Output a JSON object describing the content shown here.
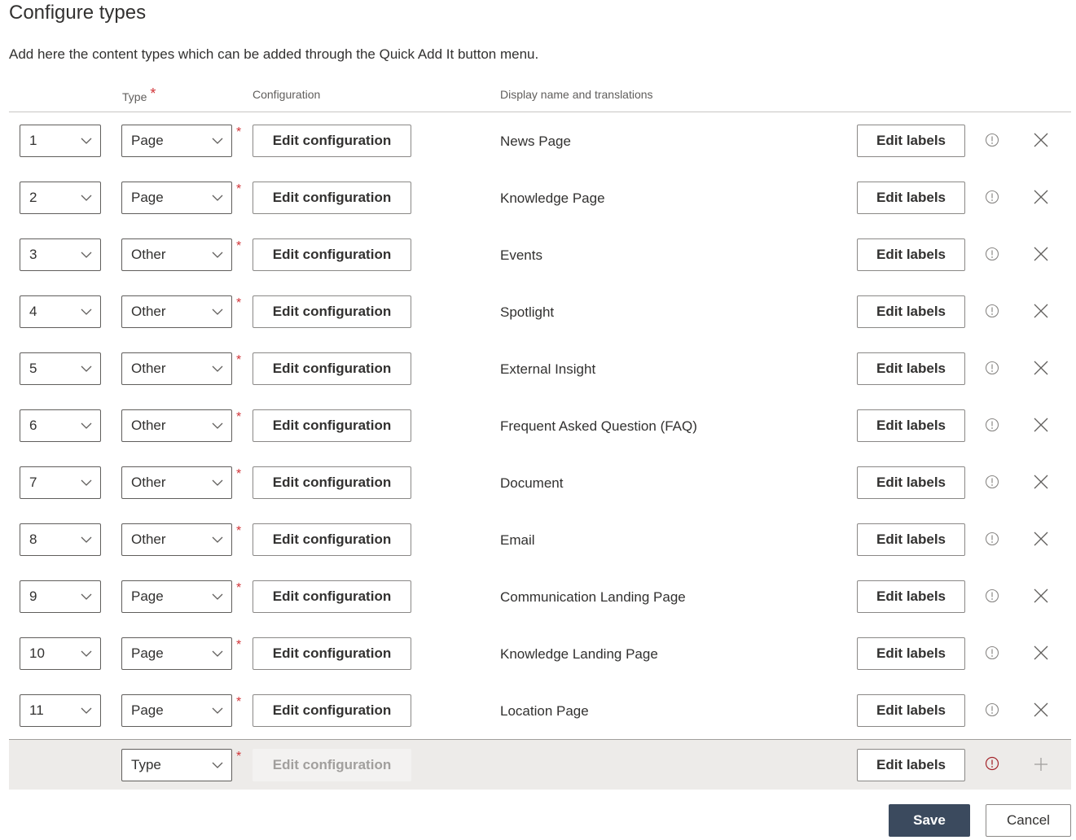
{
  "page": {
    "title": "Configure types",
    "description": "Add here the content types which can be added through the Quick Add It button menu."
  },
  "headers": {
    "type": "Type",
    "configuration": "Configuration",
    "display_name": "Display name and translations",
    "required_mark": "*"
  },
  "rows": [
    {
      "order": "1",
      "type": "Page",
      "config_label": "Edit configuration",
      "display_name": "News Page",
      "labels_label": "Edit labels"
    },
    {
      "order": "2",
      "type": "Page",
      "config_label": "Edit configuration",
      "display_name": "Knowledge Page",
      "labels_label": "Edit labels"
    },
    {
      "order": "3",
      "type": "Other",
      "config_label": "Edit configuration",
      "display_name": "Events",
      "labels_label": "Edit labels"
    },
    {
      "order": "4",
      "type": "Other",
      "config_label": "Edit configuration",
      "display_name": "Spotlight",
      "labels_label": "Edit labels"
    },
    {
      "order": "5",
      "type": "Other",
      "config_label": "Edit configuration",
      "display_name": "External Insight",
      "labels_label": "Edit labels"
    },
    {
      "order": "6",
      "type": "Other",
      "config_label": "Edit configuration",
      "display_name": "Frequent Asked Question (FAQ)",
      "labels_label": "Edit labels"
    },
    {
      "order": "7",
      "type": "Other",
      "config_label": "Edit configuration",
      "display_name": "Document",
      "labels_label": "Edit labels"
    },
    {
      "order": "8",
      "type": "Other",
      "config_label": "Edit configuration",
      "display_name": "Email",
      "labels_label": "Edit labels"
    },
    {
      "order": "9",
      "type": "Page",
      "config_label": "Edit configuration",
      "display_name": "Communication Landing Page",
      "labels_label": "Edit labels"
    },
    {
      "order": "10",
      "type": "Page",
      "config_label": "Edit configuration",
      "display_name": "Knowledge Landing Page",
      "labels_label": "Edit labels"
    },
    {
      "order": "11",
      "type": "Page",
      "config_label": "Edit configuration",
      "display_name": "Location Page",
      "labels_label": "Edit labels"
    }
  ],
  "new_row": {
    "type_placeholder": "Type",
    "config_label": "Edit configuration",
    "labels_label": "Edit labels"
  },
  "footer": {
    "save_label": "Save",
    "cancel_label": "Cancel"
  },
  "colors": {
    "required": "#d13438",
    "primary_button": "#3b4a5e",
    "info_icon": "#8a8886",
    "error_icon": "#a4262c"
  }
}
